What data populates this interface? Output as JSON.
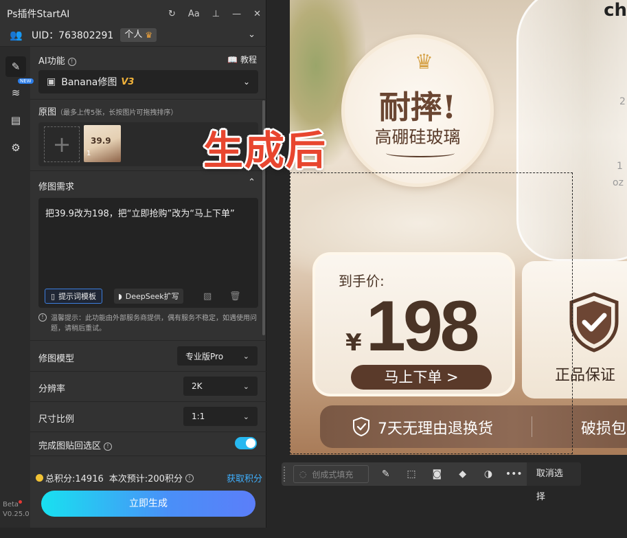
{
  "panel": {
    "title": "Ps插件StartAI",
    "uid": "UID：763802291",
    "tier": "个人",
    "rail_new_tag": "NEW",
    "beta_label": "Beta",
    "version": "V0.25.0"
  },
  "ai_function": {
    "label": "AI功能",
    "tutorial": "教程",
    "model_select": "Banana修图",
    "model_version": "V3"
  },
  "source_image": {
    "label": "原图",
    "hint": "（最多上传5张，长按图片可拖拽排序）",
    "add_symbol": "+",
    "thumb_index": "1",
    "thumb_price": "39.9"
  },
  "edit_request": {
    "label": "修图需求",
    "text": "把39.9改为198，把“立即抢购”改为“马上下单”",
    "template_button": "提示词模板",
    "deepseek_button": "DeepSeek扩写"
  },
  "notice": "温馨提示：此功能由外部服务商提供，偶有服务不稳定，如遇使用问题，请稍后重试。",
  "settings": {
    "model_label": "修图模型",
    "model_value": "专业版Pro",
    "resolution_label": "分辨率",
    "resolution_value": "2K",
    "ratio_label": "尺寸比例",
    "ratio_value": "1:1",
    "paste_back_label": "完成图贴回选区",
    "paste_back_on": true
  },
  "footer": {
    "total_points": "总积分:14916",
    "estimated": "本次预计:200积分",
    "get_points": "获取积分",
    "generate_button": "立即生成"
  },
  "canvas": {
    "caption": "生成后",
    "badge_big": "耐摔!",
    "badge_small": "高硼硅玻璃",
    "price_label": "到手价:",
    "currency": "¥",
    "price": "198",
    "buy_button": "马上下单 >",
    "guarantee": "正品保证",
    "return_policy": "7天无理由退换货",
    "damage_text": "破损包",
    "glass_marks": [
      "2",
      "1",
      "oz"
    ]
  },
  "context_toolbar": {
    "fill_placeholder": "创成式填充",
    "cancel_selection": "取消选择"
  },
  "colors": {
    "accent_blue": "#3fb0ff",
    "toggle_on": "#27b8f0",
    "caption_red": "#e8462f",
    "product_brown": "#5a3a2a"
  }
}
